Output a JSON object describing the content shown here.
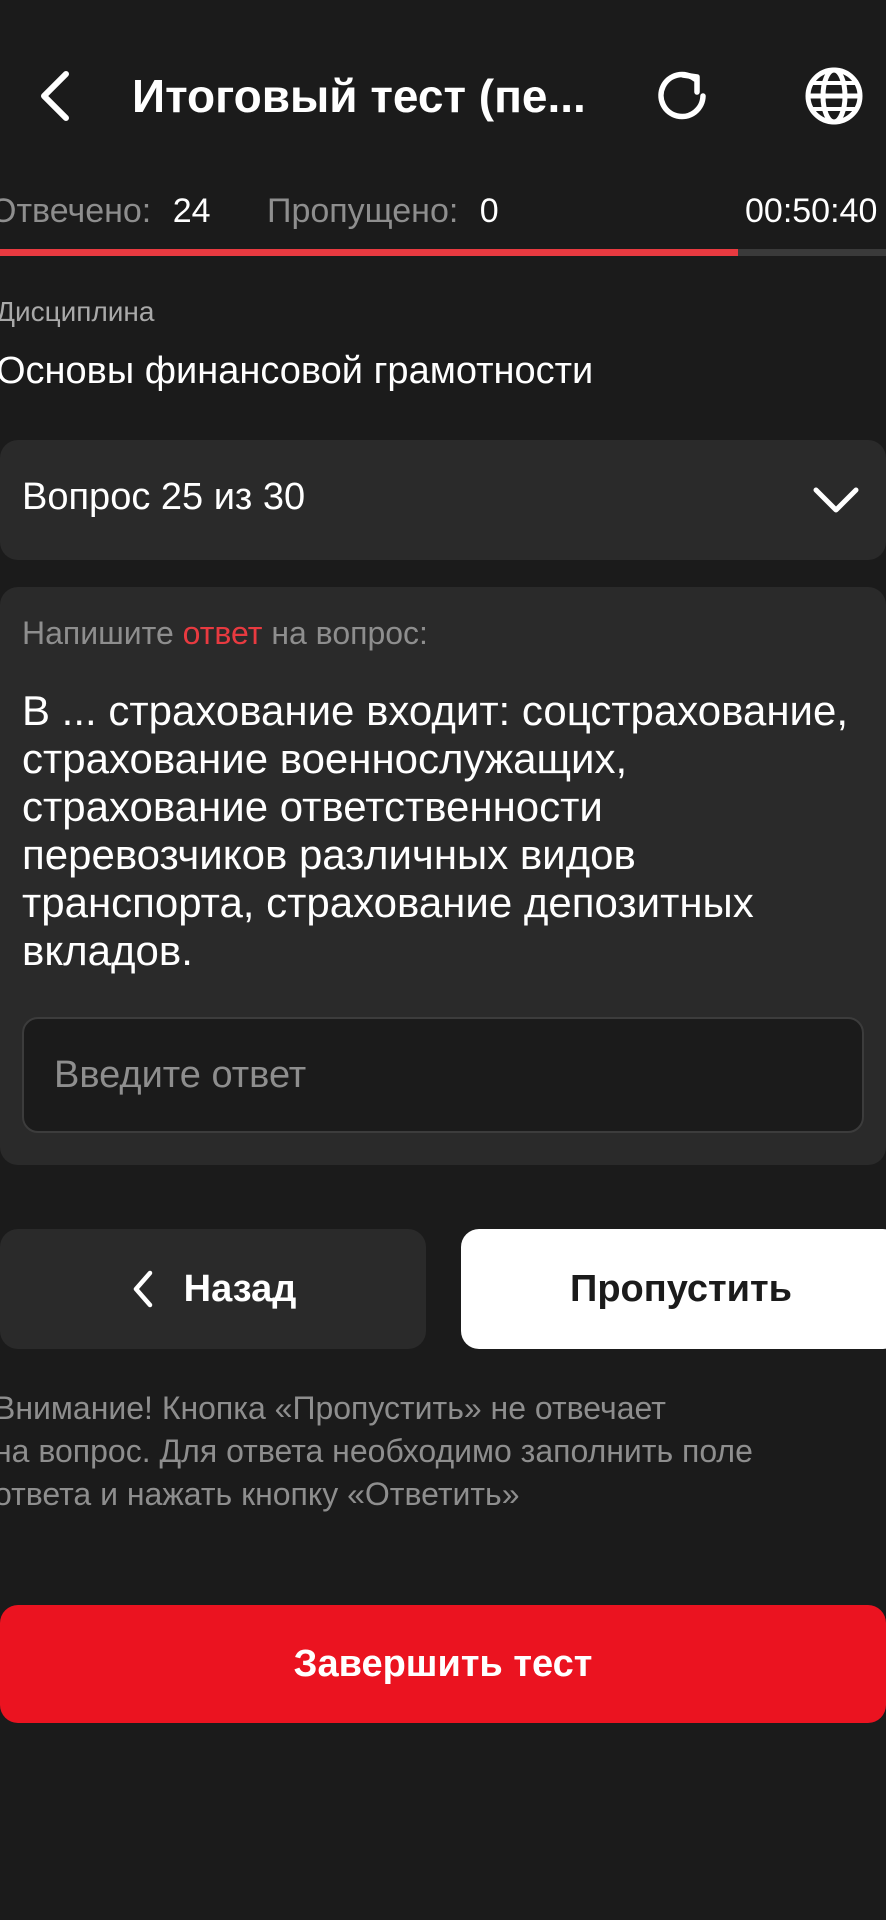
{
  "header": {
    "title": "Итоговый тест (пе...",
    "back_icon": "chevron-left-icon",
    "refresh_icon": "refresh-icon",
    "language_icon": "globe-icon"
  },
  "stats": {
    "answered_label": "Отвечено:",
    "answered_value": "24",
    "skipped_label": "Пропущено:",
    "skipped_value": "0",
    "timer": "00:50:40"
  },
  "progress": {
    "fraction": 0.833,
    "color": "#e83a40"
  },
  "discipline": {
    "label": "Дисциплина",
    "name": "Основы финансовой грамотности"
  },
  "question_selector": {
    "label": "Вопрос 25 из 30"
  },
  "question": {
    "prompt_before": "Напишите ",
    "prompt_accent": "ответ",
    "prompt_after": " на вопрос:",
    "text": "В ... страхование входит: соцстрахование, страхование военнослужащих, страхование ответственности перевозчиков различных видов транспорта, страхование депозитных вкладов.",
    "answer_placeholder": "Введите ответ"
  },
  "buttons": {
    "back_label": "Назад",
    "skip_label": "Пропустить",
    "finish_label": "Завершить тест"
  },
  "warning": "Внимание! Кнопка «Пропустить» не отвечает\nна вопрос. Для ответа необходимо заполнить поле\nответа и нажать кнопку «Ответить»",
  "colors": {
    "background": "#1b1b1b",
    "card": "#2a2a2a",
    "accent_red": "#e83a40",
    "finish_button": "#eb1320"
  }
}
